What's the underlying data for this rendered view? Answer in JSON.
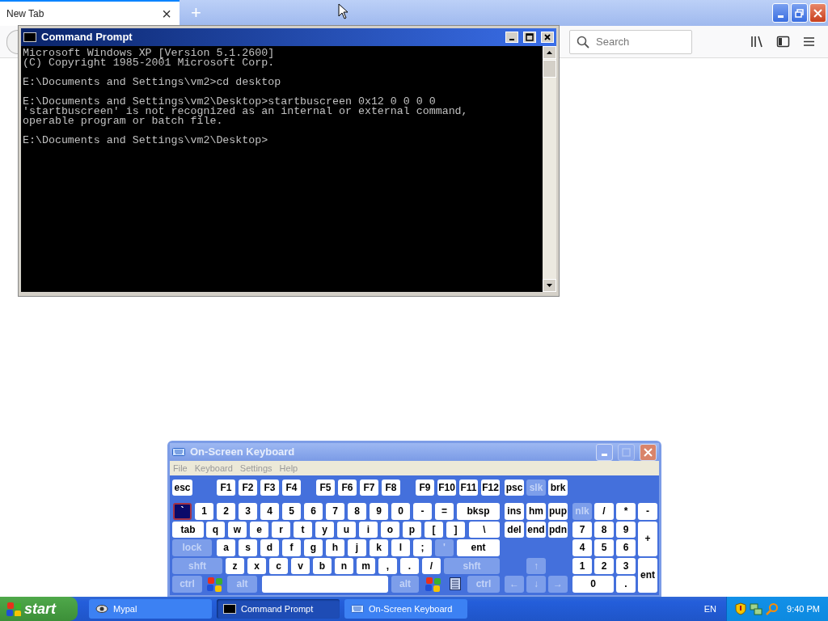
{
  "browser": {
    "tab": {
      "label": "New Tab",
      "close": "×"
    },
    "new_tab": "+",
    "search": {
      "placeholder": "Search"
    }
  },
  "command_prompt": {
    "title": "Command Prompt",
    "paragraphs": [
      [
        "Microsoft Windows XP [Version 5.1.2600]",
        "(C) Copyright 1985-2001 Microsoft Corp."
      ],
      [
        "E:\\Documents and Settings\\vm2>cd desktop"
      ],
      [
        "E:\\Documents and Settings\\vm2\\Desktop>startbuscreen 0x12 0 0 0 0",
        "'startbuscreen' is not recognized as an internal or external command,",
        "operable program or batch file."
      ],
      [
        "E:\\Documents and Settings\\vm2\\Desktop>"
      ]
    ]
  },
  "on_screen_keyboard": {
    "title": "On-Screen Keyboard",
    "menu": [
      "File",
      "Keyboard",
      "Settings",
      "Help"
    ],
    "rows": [
      {
        "keys": [
          {
            "label": "esc",
            "pressed": false,
            "disabled": false
          },
          {
            "label": "F1",
            "pressed": false,
            "disabled": false
          },
          {
            "label": "F2",
            "pressed": false,
            "disabled": false
          },
          {
            "label": "F3",
            "pressed": false,
            "disabled": false
          },
          {
            "label": "F4",
            "pressed": false,
            "disabled": false
          },
          {
            "label": "F5",
            "pressed": false,
            "disabled": false
          },
          {
            "label": "F6",
            "pressed": false,
            "disabled": false
          },
          {
            "label": "F7",
            "pressed": false,
            "disabled": false
          },
          {
            "label": "F8",
            "pressed": false,
            "disabled": false
          },
          {
            "label": "F9",
            "pressed": false,
            "disabled": false
          },
          {
            "label": "F10",
            "pressed": false,
            "disabled": false
          },
          {
            "label": "F11",
            "pressed": false,
            "disabled": false
          },
          {
            "label": "F12",
            "pressed": false,
            "disabled": false
          },
          {
            "label": "psc",
            "pressed": false,
            "disabled": false
          },
          {
            "label": "slk",
            "pressed": false,
            "disabled": true
          },
          {
            "label": "brk",
            "pressed": false,
            "disabled": false
          }
        ]
      },
      {
        "keys": [
          {
            "label": "`",
            "pressed": true,
            "disabled": false
          },
          {
            "label": "1",
            "pressed": false,
            "disabled": false
          },
          {
            "label": "2",
            "pressed": false,
            "disabled": false
          },
          {
            "label": "3",
            "pressed": false,
            "disabled": false
          },
          {
            "label": "4",
            "pressed": false,
            "disabled": false
          },
          {
            "label": "5",
            "pressed": false,
            "disabled": false
          },
          {
            "label": "6",
            "pressed": false,
            "disabled": false
          },
          {
            "label": "7",
            "pressed": false,
            "disabled": false
          },
          {
            "label": "8",
            "pressed": false,
            "disabled": false
          },
          {
            "label": "9",
            "pressed": false,
            "disabled": false
          },
          {
            "label": "0",
            "pressed": false,
            "disabled": false
          },
          {
            "label": "-",
            "pressed": false,
            "disabled": false
          },
          {
            "label": "=",
            "pressed": false,
            "disabled": false
          },
          {
            "label": "bksp",
            "pressed": false,
            "disabled": false
          },
          {
            "label": "ins",
            "pressed": false,
            "disabled": false
          },
          {
            "label": "hm",
            "pressed": false,
            "disabled": false
          },
          {
            "label": "pup",
            "pressed": false,
            "disabled": false
          },
          {
            "label": "nlk",
            "pressed": false,
            "disabled": true
          },
          {
            "label": "/",
            "pressed": false,
            "disabled": false
          },
          {
            "label": "*",
            "pressed": false,
            "disabled": false
          },
          {
            "label": "-",
            "pressed": false,
            "disabled": false
          }
        ]
      },
      {
        "keys": [
          {
            "label": "tab",
            "pressed": false,
            "disabled": false
          },
          {
            "label": "q",
            "pressed": false,
            "disabled": false
          },
          {
            "label": "w",
            "pressed": false,
            "disabled": false
          },
          {
            "label": "e",
            "pressed": false,
            "disabled": false
          },
          {
            "label": "r",
            "pressed": false,
            "disabled": false
          },
          {
            "label": "t",
            "pressed": false,
            "disabled": false
          },
          {
            "label": "y",
            "pressed": false,
            "disabled": false
          },
          {
            "label": "u",
            "pressed": false,
            "disabled": false
          },
          {
            "label": "i",
            "pressed": false,
            "disabled": false
          },
          {
            "label": "o",
            "pressed": false,
            "disabled": false
          },
          {
            "label": "p",
            "pressed": false,
            "disabled": false
          },
          {
            "label": "[",
            "pressed": false,
            "disabled": false
          },
          {
            "label": "]",
            "pressed": false,
            "disabled": false
          },
          {
            "label": "\\",
            "pressed": false,
            "disabled": false
          },
          {
            "label": "del",
            "pressed": false,
            "disabled": false
          },
          {
            "label": "end",
            "pressed": false,
            "disabled": false
          },
          {
            "label": "pdn",
            "pressed": false,
            "disabled": false
          },
          {
            "label": "7",
            "pressed": false,
            "disabled": false
          },
          {
            "label": "8",
            "pressed": false,
            "disabled": false
          },
          {
            "label": "9",
            "pressed": false,
            "disabled": false
          },
          {
            "label": "+",
            "pressed": false,
            "disabled": false
          }
        ]
      },
      {
        "keys": [
          {
            "label": "lock",
            "pressed": false,
            "disabled": true
          },
          {
            "label": "a",
            "pressed": false,
            "disabled": false
          },
          {
            "label": "s",
            "pressed": false,
            "disabled": false
          },
          {
            "label": "d",
            "pressed": false,
            "disabled": false
          },
          {
            "label": "f",
            "pressed": false,
            "disabled": false
          },
          {
            "label": "g",
            "pressed": false,
            "disabled": false
          },
          {
            "label": "h",
            "pressed": false,
            "disabled": false
          },
          {
            "label": "j",
            "pressed": false,
            "disabled": false
          },
          {
            "label": "k",
            "pressed": false,
            "disabled": false
          },
          {
            "label": "l",
            "pressed": false,
            "disabled": false
          },
          {
            "label": ";",
            "pressed": false,
            "disabled": false
          },
          {
            "label": "'",
            "pressed": false,
            "disabled": true
          },
          {
            "label": "ent",
            "pressed": false,
            "disabled": false
          },
          {
            "label": "4",
            "pressed": false,
            "disabled": false
          },
          {
            "label": "5",
            "pressed": false,
            "disabled": false
          },
          {
            "label": "6",
            "pressed": false,
            "disabled": false
          }
        ]
      },
      {
        "keys": [
          {
            "label": "shft",
            "pressed": false,
            "disabled": true
          },
          {
            "label": "z",
            "pressed": false,
            "disabled": false
          },
          {
            "label": "x",
            "pressed": false,
            "disabled": false
          },
          {
            "label": "c",
            "pressed": false,
            "disabled": false
          },
          {
            "label": "v",
            "pressed": false,
            "disabled": false
          },
          {
            "label": "b",
            "pressed": false,
            "disabled": false
          },
          {
            "label": "n",
            "pressed": false,
            "disabled": false
          },
          {
            "label": "m",
            "pressed": false,
            "disabled": false
          },
          {
            "label": ",",
            "pressed": false,
            "disabled": false
          },
          {
            "label": ".",
            "pressed": false,
            "disabled": false
          },
          {
            "label": "/",
            "pressed": false,
            "disabled": false
          },
          {
            "label": "shft",
            "pressed": false,
            "disabled": true
          },
          {
            "label": "↑",
            "pressed": false,
            "disabled": true
          },
          {
            "label": "1",
            "pressed": false,
            "disabled": false
          },
          {
            "label": "2",
            "pressed": false,
            "disabled": false
          },
          {
            "label": "3",
            "pressed": false,
            "disabled": false
          },
          {
            "label": "ent",
            "pressed": false,
            "disabled": false
          }
        ]
      },
      {
        "keys": [
          {
            "label": "ctrl",
            "pressed": false,
            "disabled": true
          },
          {
            "kind": "windows",
            "pressed": false,
            "disabled": false
          },
          {
            "label": "alt",
            "pressed": false,
            "disabled": true
          },
          {
            "kind": "space",
            "pressed": false,
            "disabled": false
          },
          {
            "label": "alt",
            "pressed": false,
            "disabled": true
          },
          {
            "kind": "windows",
            "pressed": false,
            "disabled": false
          },
          {
            "kind": "menu",
            "pressed": false,
            "disabled": false
          },
          {
            "label": "ctrl",
            "pressed": false,
            "disabled": true
          },
          {
            "label": "←",
            "pressed": false,
            "disabled": true
          },
          {
            "label": "↓",
            "pressed": false,
            "disabled": true
          },
          {
            "label": "→",
            "pressed": false,
            "disabled": true
          },
          {
            "label": "0",
            "pressed": false,
            "disabled": false
          },
          {
            "label": ".",
            "pressed": false,
            "disabled": false
          }
        ]
      }
    ]
  },
  "taskbar": {
    "start": "start",
    "tasks": [
      {
        "label": "Mypal",
        "selected": false
      },
      {
        "label": "Command Prompt",
        "selected": true
      },
      {
        "label": "On-Screen Keyboard",
        "selected": false
      }
    ],
    "language": "EN",
    "clock": "9:40 PM"
  }
}
